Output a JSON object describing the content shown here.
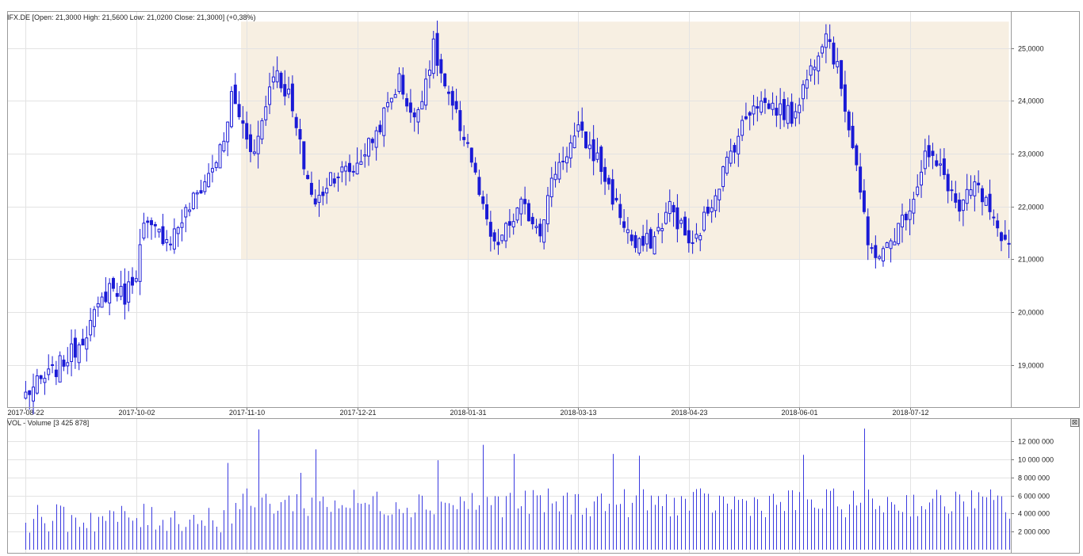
{
  "price_panel": {
    "header": "IFX.DE [Open: 21,3000  High: 21,5600  Low: 21,0200  Close: 21,3000] (+0,38%)"
  },
  "volume_panel": {
    "header": "VOL - Volume [3 425 878]"
  },
  "colors": {
    "candle": "#1a1ad6",
    "volume": "#3a3ae0",
    "highlight_zone": "#f7efe2"
  },
  "icons": {
    "panel_close": "close-icon"
  },
  "close_glyph": "⊠",
  "chart_data": [
    {
      "type": "candlestick",
      "symbol": "IFX.DE",
      "x_ticks": [
        "2017-08-22",
        "2017-10-02",
        "2017-11-10",
        "2017-12-21",
        "2018-01-31",
        "2018-03-13",
        "2018-04-23",
        "2018-06-01",
        "2018-07-12"
      ],
      "y_ticks": [
        "19,0000",
        "20,0000",
        "21,0000",
        "22,0000",
        "23,0000",
        "24,0000",
        "25,0000"
      ],
      "ylim": [
        18.2,
        25.7
      ],
      "grid": true,
      "highlight_zone": {
        "x_start": "2017-11-09",
        "x_end": "2018-08-31",
        "y_range": [
          21.0,
          25.5
        ]
      },
      "last_bar": {
        "open": 21.3,
        "high": 21.56,
        "low": 21.02,
        "close": 21.3,
        "change": "+0,38%"
      },
      "anchors_close": [
        [
          "2017-08-22",
          18.45
        ],
        [
          "2017-08-31",
          18.85
        ],
        [
          "2017-09-08",
          19.3
        ],
        [
          "2017-09-15",
          19.9
        ],
        [
          "2017-09-21",
          20.5
        ],
        [
          "2017-09-27",
          20.3
        ],
        [
          "2017-10-02",
          20.8
        ],
        [
          "2017-10-04",
          21.6
        ],
        [
          "2017-10-13",
          21.4
        ],
        [
          "2017-10-20",
          22.0
        ],
        [
          "2017-10-27",
          22.6
        ],
        [
          "2017-11-02",
          23.2
        ],
        [
          "2017-11-06",
          24.1
        ],
        [
          "2017-11-14",
          23.0
        ],
        [
          "2017-11-21",
          24.6
        ],
        [
          "2017-11-27",
          24.1
        ],
        [
          "2017-12-01",
          22.8
        ],
        [
          "2017-12-06",
          22.0
        ],
        [
          "2017-12-12",
          22.6
        ],
        [
          "2017-12-20",
          22.7
        ],
        [
          "2017-12-28",
          23.4
        ],
        [
          "2018-01-05",
          24.4
        ],
        [
          "2018-01-11",
          23.6
        ],
        [
          "2018-01-18",
          25.0
        ],
        [
          "2018-01-24",
          24.0
        ],
        [
          "2018-01-31",
          23.2
        ],
        [
          "2018-02-06",
          21.9
        ],
        [
          "2018-02-09",
          21.2
        ],
        [
          "2018-02-20",
          22.0
        ],
        [
          "2018-02-27",
          21.6
        ],
        [
          "2018-03-05",
          22.7
        ],
        [
          "2018-03-13",
          23.4
        ],
        [
          "2018-03-20",
          22.9
        ],
        [
          "2018-03-27",
          22.0
        ],
        [
          "2018-04-03",
          21.2
        ],
        [
          "2018-04-10",
          21.4
        ],
        [
          "2018-04-16",
          22.0
        ],
        [
          "2018-04-24",
          21.2
        ],
        [
          "2018-05-02",
          22.3
        ],
        [
          "2018-05-09",
          23.2
        ],
        [
          "2018-05-16",
          24.0
        ],
        [
          "2018-05-23",
          23.9
        ],
        [
          "2018-05-30",
          23.7
        ],
        [
          "2018-06-06",
          24.6
        ],
        [
          "2018-06-12",
          25.4
        ],
        [
          "2018-06-18",
          24.3
        ],
        [
          "2018-06-22",
          22.8
        ],
        [
          "2018-06-27",
          21.2
        ],
        [
          "2018-07-03",
          21.1
        ],
        [
          "2018-07-09",
          21.6
        ],
        [
          "2018-07-13",
          22.2
        ],
        [
          "2018-07-18",
          23.0
        ],
        [
          "2018-07-25",
          22.6
        ],
        [
          "2018-07-31",
          21.9
        ],
        [
          "2018-08-06",
          22.4
        ],
        [
          "2018-08-10",
          21.9
        ],
        [
          "2018-08-15",
          21.2
        ],
        [
          "2018-08-17",
          21.3
        ]
      ]
    },
    {
      "type": "bar",
      "series": [
        {
          "name": "Volume",
          "values": []
        }
      ],
      "y_ticks": [
        "2 000 000",
        "4 000 000",
        "6 000 000",
        "8 000 000",
        "10 000 000",
        "12 000 000"
      ],
      "ylim": [
        0,
        13500000
      ],
      "last_value": 3425878,
      "spikes": [
        [
          "2017-11-15",
          13300000
        ],
        [
          "2017-12-06",
          11100000
        ],
        [
          "2018-02-06",
          11600000
        ],
        [
          "2018-02-16",
          10600000
        ],
        [
          "2018-01-19",
          9900000
        ],
        [
          "2018-06-26",
          13400000
        ],
        [
          "2018-06-04",
          10500000
        ],
        [
          "2018-04-04",
          10400000
        ],
        [
          "2018-03-26",
          10600000
        ],
        [
          "2017-11-03",
          9600000
        ],
        [
          "2017-11-30",
          8500000
        ]
      ]
    }
  ]
}
